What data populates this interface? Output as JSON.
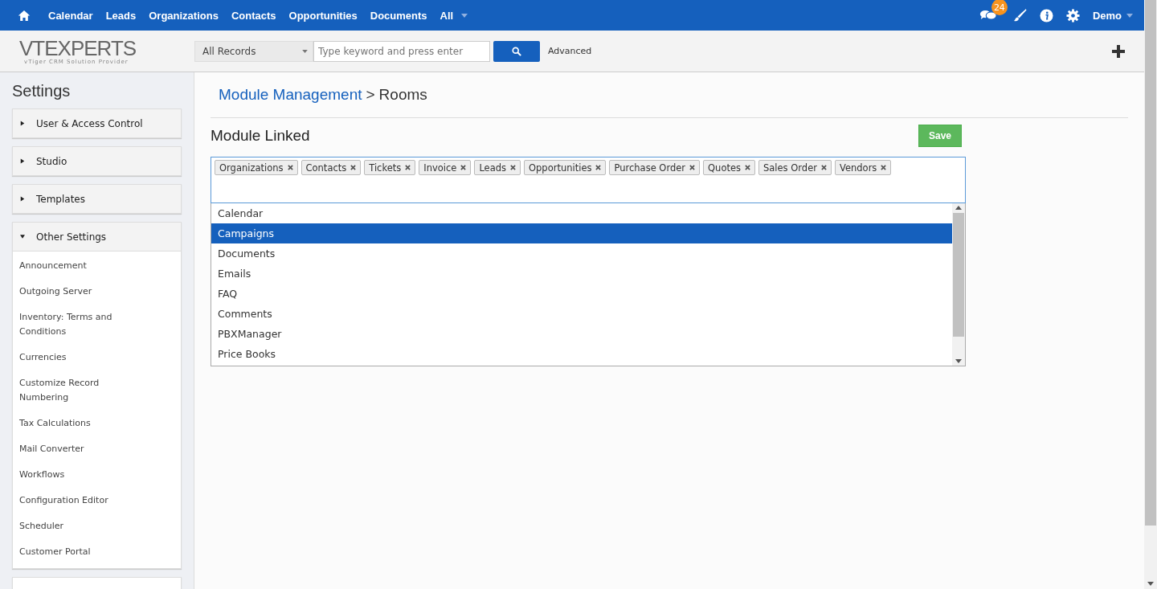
{
  "top_nav": {
    "items": [
      "Calendar",
      "Leads",
      "Organizations",
      "Contacts",
      "Opportunities",
      "Documents",
      "All"
    ],
    "notification_count": "24",
    "user": "Demo"
  },
  "logo": {
    "name": "VTEXPERTS",
    "tagline": "vTiger CRM Solution Provider"
  },
  "search": {
    "scope": "All Records",
    "placeholder": "Type keyword and press enter",
    "advanced": "Advanced"
  },
  "sidebar": {
    "title": "Settings",
    "sections": [
      {
        "label": "User & Access Control",
        "expanded": false
      },
      {
        "label": "Studio",
        "expanded": false
      },
      {
        "label": "Templates",
        "expanded": false
      },
      {
        "label": "Other Settings",
        "expanded": true,
        "children": [
          "Announcement",
          "Outgoing Server",
          "Inventory: Terms and Conditions",
          "Currencies",
          "Customize Record Numbering",
          "Tax Calculations",
          "Mail Converter",
          "Workflows",
          "Configuration Editor",
          "Scheduler",
          "Customer Portal"
        ]
      }
    ]
  },
  "breadcrumb": {
    "parent": "Module Management",
    "separator": ">",
    "current": "Rooms"
  },
  "section": {
    "title": "Module Linked",
    "save": "Save"
  },
  "tags": [
    "Organizations",
    "Contacts",
    "Tickets",
    "Invoice",
    "Leads",
    "Opportunities",
    "Purchase Order",
    "Quotes",
    "Sales Order",
    "Vendors"
  ],
  "options": [
    {
      "label": "Calendar",
      "selected": false
    },
    {
      "label": "Campaigns",
      "selected": true
    },
    {
      "label": "Documents",
      "selected": false
    },
    {
      "label": "Emails",
      "selected": false
    },
    {
      "label": "FAQ",
      "selected": false
    },
    {
      "label": "Comments",
      "selected": false
    },
    {
      "label": "PBXManager",
      "selected": false
    },
    {
      "label": "Price Books",
      "selected": false
    }
  ]
}
